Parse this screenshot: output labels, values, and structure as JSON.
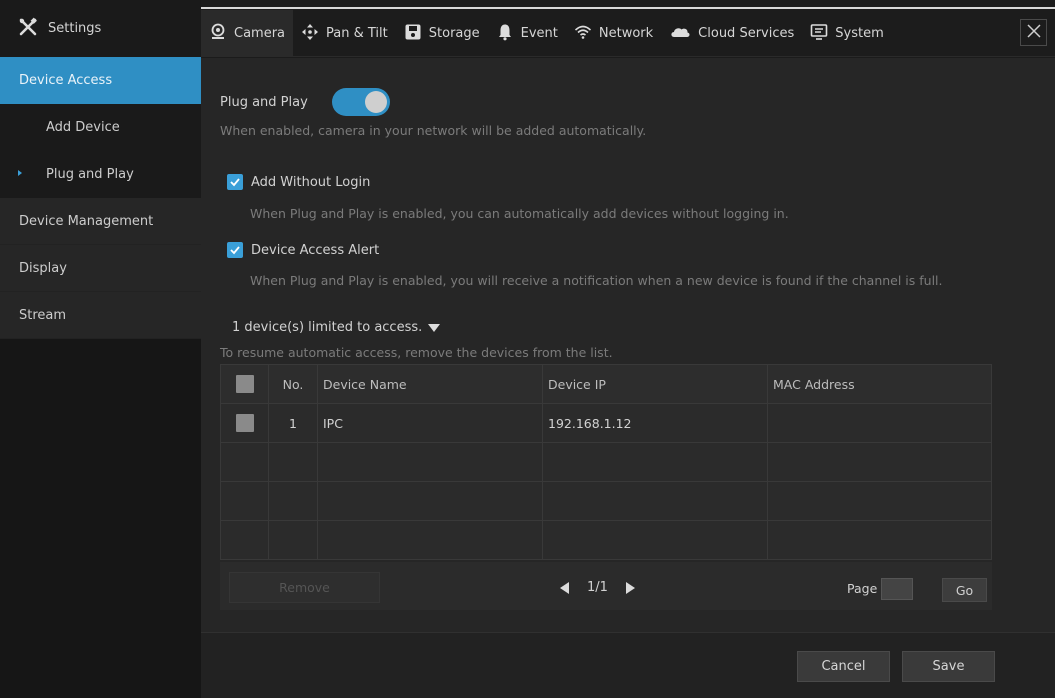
{
  "sidebar": {
    "title": "Settings",
    "title_icon": "tools-icon",
    "items": [
      {
        "label": "Device Access",
        "active": true
      },
      {
        "label": "Add Device"
      },
      {
        "label": "Plug and Play"
      },
      {
        "label": "Device Management"
      },
      {
        "label": "Display"
      },
      {
        "label": "Stream"
      }
    ]
  },
  "tabs": [
    {
      "label": "Camera",
      "icon": "camera-icon",
      "active": true
    },
    {
      "label": "Pan & Tilt",
      "icon": "pan-tilt-icon"
    },
    {
      "label": "Storage",
      "icon": "storage-icon"
    },
    {
      "label": "Event",
      "icon": "bell-icon"
    },
    {
      "label": "Network",
      "icon": "wifi-icon"
    },
    {
      "label": "Cloud Services",
      "icon": "cloud-icon"
    },
    {
      "label": "System",
      "icon": "monitor-icon"
    }
  ],
  "plug_and_play": {
    "label": "Plug and Play",
    "enabled": true,
    "hint": "When enabled, camera in your network will be added automatically."
  },
  "options": [
    {
      "label": "Add Without Login",
      "checked": true,
      "hint": "When Plug and Play is enabled, you can automatically add devices without logging in."
    },
    {
      "label": "Device Access Alert",
      "checked": true,
      "hint": "When Plug and Play is enabled, you will receive a notification when a new device is found if the channel is full."
    }
  ],
  "limited": {
    "label": "1 device(s) limited to access.",
    "hint": "To resume automatic access, remove the devices from the list."
  },
  "table": {
    "headers": {
      "no": "No.",
      "name": "Device Name",
      "ip": "Device IP",
      "mac": "MAC Address"
    },
    "rows": [
      {
        "no": "1",
        "name": "IPC",
        "ip": "192.168.1.12",
        "mac": ""
      }
    ]
  },
  "pagination": {
    "remove_label": "Remove",
    "page_text": "1/1",
    "page_label": "Page",
    "page_value": "",
    "go_label": "Go"
  },
  "actions": {
    "cancel": "Cancel",
    "save": "Save"
  },
  "colors": {
    "accent": "#2f8fc4",
    "background": "#262626"
  }
}
